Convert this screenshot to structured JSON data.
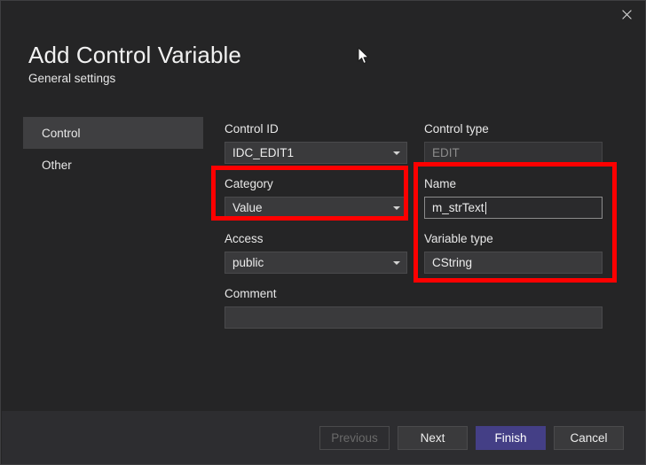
{
  "window": {
    "close_label": "✕"
  },
  "header": {
    "title": "Add Control Variable",
    "subtitle": "General settings"
  },
  "sidebar": {
    "items": [
      {
        "label": "Control",
        "selected": true
      },
      {
        "label": "Other",
        "selected": false
      }
    ]
  },
  "form": {
    "control_id": {
      "label": "Control ID",
      "value": "IDC_EDIT1"
    },
    "control_type": {
      "label": "Control type",
      "value": "EDIT"
    },
    "category": {
      "label": "Category",
      "value": "Value"
    },
    "name": {
      "label": "Name",
      "value": "m_strText"
    },
    "access": {
      "label": "Access",
      "value": "public"
    },
    "variable_type": {
      "label": "Variable type",
      "value": "CString"
    },
    "comment": {
      "label": "Comment",
      "value": ""
    }
  },
  "footer": {
    "previous_label": "Previous",
    "next_label": "Next",
    "finish_label": "Finish",
    "cancel_label": "Cancel"
  },
  "annotations": {
    "color": "#fe0000",
    "boxes": [
      {
        "target": "category-field"
      },
      {
        "target": "name-and-variable-type-fields"
      }
    ]
  },
  "theme": {
    "dialog_background": "#252526",
    "footer_background": "#2d2d30",
    "accent": "#443f86",
    "selected_item": "#3f3f41"
  }
}
